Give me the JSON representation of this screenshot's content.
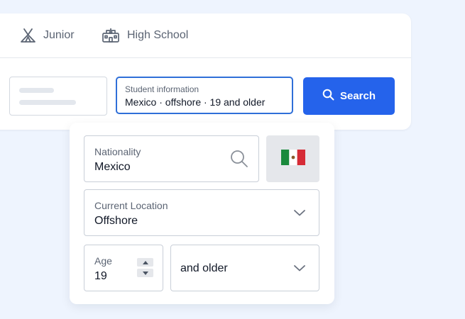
{
  "tabs": [
    {
      "label": "Junior",
      "icon": "tent-icon"
    },
    {
      "label": "High School",
      "icon": "school-icon"
    }
  ],
  "search_bar": {
    "student_info_label": "Student information",
    "student_info_value": "Mexico · offshore · 19 and older",
    "search_button_label": "Search"
  },
  "filters": {
    "nationality": {
      "label": "Nationality",
      "value": "Mexico",
      "flag": "mexico-flag-icon"
    },
    "current_location": {
      "label": "Current Location",
      "value": "Offshore"
    },
    "age": {
      "label": "Age",
      "value": "19"
    },
    "age_range": {
      "value": "and older"
    }
  },
  "colors": {
    "accent": "#2563eb",
    "page_background": "#eef4fe",
    "focus_border": "#2f6fd8"
  }
}
